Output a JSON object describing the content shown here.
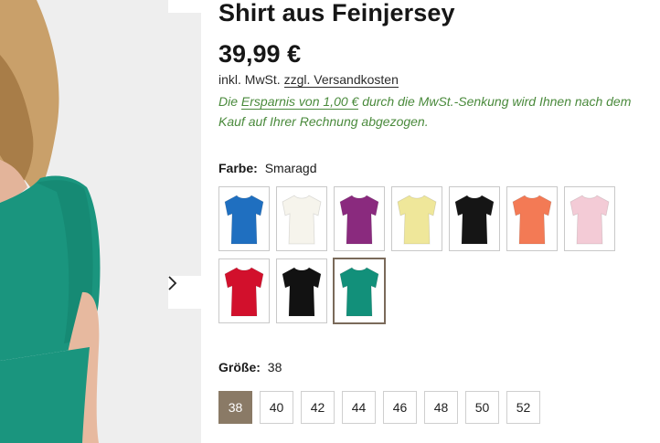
{
  "product": {
    "title": "Shirt aus Feinjersey",
    "price": "39,99 €",
    "tax_prefix": "inkl. MwSt.",
    "tax_link": "zzgl. Versandkosten",
    "saving_before": "Die ",
    "saving_highlight": "Ersparnis von 1,00 €",
    "saving_after": " durch die MwSt.-Senkung wird Ihnen nach dem Kauf auf Ihrer Rechnung abgezogen."
  },
  "color": {
    "label": "Farbe:",
    "selected": "Smaragd",
    "swatches": [
      {
        "color": "#1f6fc0",
        "icon": "tshirt-icon"
      },
      {
        "color": "#f6f4ec",
        "icon": "tshirt-icon"
      },
      {
        "color": "#8a2a7e",
        "icon": "tshirt-icon"
      },
      {
        "color": "#efe79a",
        "icon": "tshirt-icon"
      },
      {
        "color": "#151515",
        "icon": "tshirt-icon"
      },
      {
        "color": "#f37a55",
        "icon": "tshirt-icon"
      },
      {
        "color": "#f3cbd6",
        "icon": "tshirt-icon"
      },
      {
        "color": "#d2102c",
        "icon": "tshirt-icon"
      },
      {
        "color": "#121212",
        "icon": "tshirt-icon"
      },
      {
        "color": "#12907a",
        "icon": "tshirt-icon"
      }
    ],
    "selected_index": 9
  },
  "size": {
    "label": "Größe:",
    "selected": "38",
    "options": [
      "38",
      "40",
      "42",
      "44",
      "46",
      "48",
      "50",
      "52"
    ]
  },
  "gallery": {
    "shirt_color": "#1a957e"
  }
}
